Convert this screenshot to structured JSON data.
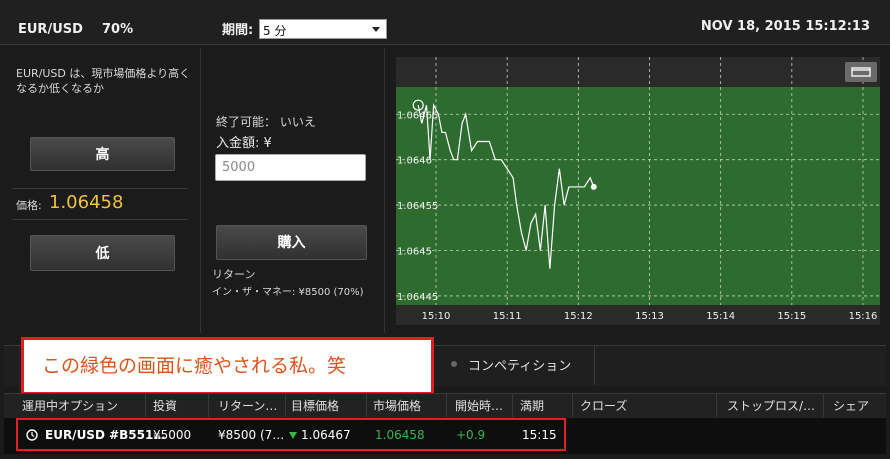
{
  "header": {
    "pair": "EUR/USD",
    "payout": "70%",
    "period_label": "期間:",
    "period_value": "5 分",
    "datetime": "NOV 18, 2015 15:12:13"
  },
  "left": {
    "description": "EUR/USD は、現市場価格より高くなるか低くなるか",
    "high_label": "高",
    "low_label": "低",
    "price_label": "価格:",
    "price_value": "1.06458"
  },
  "middle": {
    "end_label": "終了可能： いいえ",
    "deposit_label": "入金額: ¥",
    "deposit_placeholder": "5000",
    "buy_label": "購入",
    "return_label": "リターン",
    "itm_label": "イン・ザ・マネー: ¥8500 (70%)"
  },
  "chart_data": {
    "type": "line",
    "y_ticks": [
      "1.06465",
      "1.0646",
      "1.06455",
      "1.0645",
      "1.06445"
    ],
    "x_ticks": [
      "15:10",
      "15:11",
      "15:12",
      "15:13",
      "15:14",
      "15:15",
      "15:16"
    ],
    "ylim": [
      1.06444,
      1.06468
    ],
    "grid": true,
    "background": "#2e6b2e",
    "line_color": "#ffffff",
    "series": [
      {
        "x": [
          "15:09:45",
          "15:09:48",
          "15:09:52",
          "15:09:55",
          "15:09:58",
          "15:10:02",
          "15:10:05",
          "15:10:08",
          "15:10:12",
          "15:10:15",
          "15:10:18",
          "15:10:22",
          "15:10:25",
          "15:10:30",
          "15:10:35",
          "15:10:40",
          "15:10:45",
          "15:10:50",
          "15:10:55",
          "15:11:00",
          "15:11:05",
          "15:11:08",
          "15:11:12",
          "15:11:16",
          "15:11:20",
          "15:11:24",
          "15:11:28",
          "15:11:32",
          "15:11:36",
          "15:11:40",
          "15:11:44",
          "15:11:48",
          "15:11:52",
          "15:11:56",
          "15:12:00",
          "15:12:05",
          "15:12:10",
          "15:12:13"
        ],
        "y": [
          1.06466,
          1.06464,
          1.06466,
          1.0646,
          1.06466,
          1.06465,
          1.06463,
          1.06463,
          1.06461,
          1.0646,
          1.0646,
          1.06464,
          1.06465,
          1.06461,
          1.06462,
          1.06462,
          1.06462,
          1.0646,
          1.0646,
          1.06459,
          1.06458,
          1.06455,
          1.06452,
          1.0645,
          1.06453,
          1.06454,
          1.0645,
          1.06455,
          1.06448,
          1.06455,
          1.06459,
          1.06455,
          1.06457,
          1.06457,
          1.06457,
          1.06457,
          1.06458,
          1.06457
        ]
      }
    ]
  },
  "bottom": {
    "callout": "この緑色の画面に癒やされる私。笑",
    "tab_competition": "コンペティション",
    "columns": [
      "運用中オプション",
      "投資",
      "リターン…",
      "目標価格",
      "市場価格",
      "開始時…",
      "満期",
      "クローズ",
      "ストップロス/…",
      "シェア"
    ],
    "row": {
      "option": "EUR/USD #B551…",
      "investment": "¥5000",
      "return": "¥8500 (7…",
      "target": "1.06467",
      "market": "1.06458",
      "change": "+0.9",
      "expiry": "15:15"
    }
  },
  "colors": {
    "price": "#f0c23a",
    "positive": "#39b54a",
    "chart_bg": "#2e6b2e",
    "highlight": "#e02020",
    "callout_text": "#e0531a"
  }
}
